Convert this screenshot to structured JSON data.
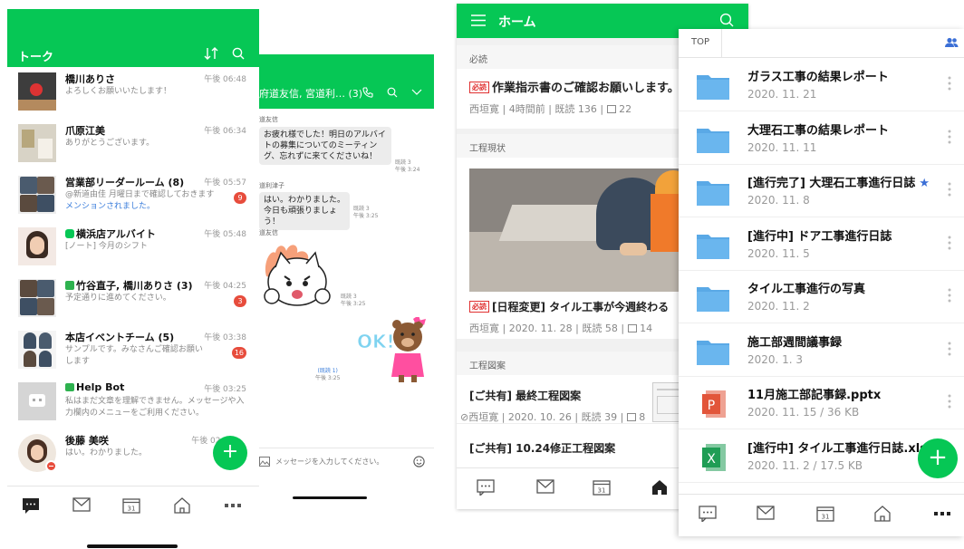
{
  "talk": {
    "header_title": "トーク",
    "chats": [
      {
        "name": "橋川ありさ",
        "time": "午後 06:48",
        "preview": "よろしくお願いいたします！"
      },
      {
        "name": "爪原江美",
        "time": "午後 06:34",
        "preview": "ありがとうございます。"
      },
      {
        "name": "営業部リーダールーム (8)",
        "time": "午後 05:57",
        "preview": "@新道由佳 月曜日まで確認しておきます",
        "mention": "メンションされました。",
        "badge": "9"
      },
      {
        "name": "横浜店アルバイト",
        "time": "午後 05:48",
        "preview": "[ノート] 今月のシフト"
      },
      {
        "name": "竹谷直子, 橋川ありさ (3)",
        "time": "午後 04:25",
        "preview": "予定通りに進めてください。",
        "badge": "3"
      },
      {
        "name": "本店イベントチーム (5)",
        "time": "午後 03:38",
        "preview": "サンプルです。みなさんご確認お願いします",
        "badge": "16"
      },
      {
        "name": "Help Bot",
        "time": "午後 03:25",
        "preview": "私はまだ文章を理解できません。メッセージや入力欄内のメニューをご利用ください。"
      },
      {
        "name": "後藤 美咲",
        "time": "午後 02:12",
        "preview": "はい。わかりました。"
      }
    ],
    "fab": "+"
  },
  "chatroom": {
    "title": "府道友信, 宮道利… (3)",
    "messages": [
      {
        "sender": "道友信",
        "text": "お疲れ様でした！明日のアルバイトの募集についてのミーティング、忘れずに来てくださいね！",
        "meta_read": "既読 3",
        "meta_time": "午後 3:24"
      },
      {
        "sender": "道利津子",
        "text": "はい。わかりました。今日も頑張りましょう！",
        "meta_read": "既読 3",
        "meta_time": "午後 3:25"
      },
      {
        "sender": "道友信",
        "text": "",
        "meta_read": "既読 3",
        "meta_time": "午後 3:25"
      }
    ],
    "sticker_text": "OK!",
    "own_read": "(既読 1)",
    "own_time": "午後 3:25",
    "input_placeholder": "メッセージを入力してください。"
  },
  "home": {
    "header_title": "ホーム",
    "sections": [
      {
        "label": "必読",
        "badge": "必読",
        "title": "作業指示書のご確認お願いします。",
        "meta": "西垣寛 | 4時間前 | 既読 136 |",
        "comments": "22"
      },
      {
        "label": "工程現状",
        "badge": "必読",
        "title": "[日程変更] タイル工事が今週終わる",
        "meta": "西垣寛 | 2020. 11. 28 | 既読 58 |",
        "comments": "14"
      },
      {
        "label": "工程図案",
        "items": [
          {
            "title": "[ご共有] 最終工程図案",
            "meta": "西垣寛 | 2020. 10. 26 | 既読 39 |",
            "comments": "8"
          },
          {
            "title": "[ご共有] 10.24修正工程図案"
          }
        ]
      }
    ]
  },
  "folders": {
    "top_label": "TOP",
    "items": [
      {
        "title": "ガラス工事の結果レポート",
        "date": "2020. 11. 21",
        "icon": "folder-icon"
      },
      {
        "title": "大理石工事の結果レポート",
        "date": "2020. 11. 11",
        "icon": "folder-icon"
      },
      {
        "title": "[進行完了] 大理石工事進行日誌",
        "date": "2020. 11. 8",
        "icon": "folder-icon",
        "star": "★"
      },
      {
        "title": "[進行中] ドア工事進行日誌",
        "date": "2020. 11. 5",
        "icon": "folder-icon"
      },
      {
        "title": "タイル工事進行の写真",
        "date": "2020. 11. 2",
        "icon": "folder-icon"
      },
      {
        "title": "施工部週間議事録",
        "date": "2020. 1. 3",
        "icon": "folder-icon"
      },
      {
        "title": "11月施工部記事録.pptx",
        "date": "2020. 11. 15 / 36 KB",
        "icon": "powerpoint-icon",
        "icon_letter": "P"
      },
      {
        "title": "[進行中] タイル工事進行日誌.xls",
        "date": "2020. 11. 2 / 17.5 KB",
        "icon": "excel-icon",
        "icon_letter": "X"
      }
    ],
    "fab": "+"
  },
  "tabs": {
    "calendar_day": "31"
  },
  "colors": {
    "brand_green": "#06c755",
    "badge_red": "#e74c3c",
    "folder_blue": "#5aa9e6",
    "ppt_orange": "#e2553a",
    "xls_green": "#1f9d55"
  }
}
